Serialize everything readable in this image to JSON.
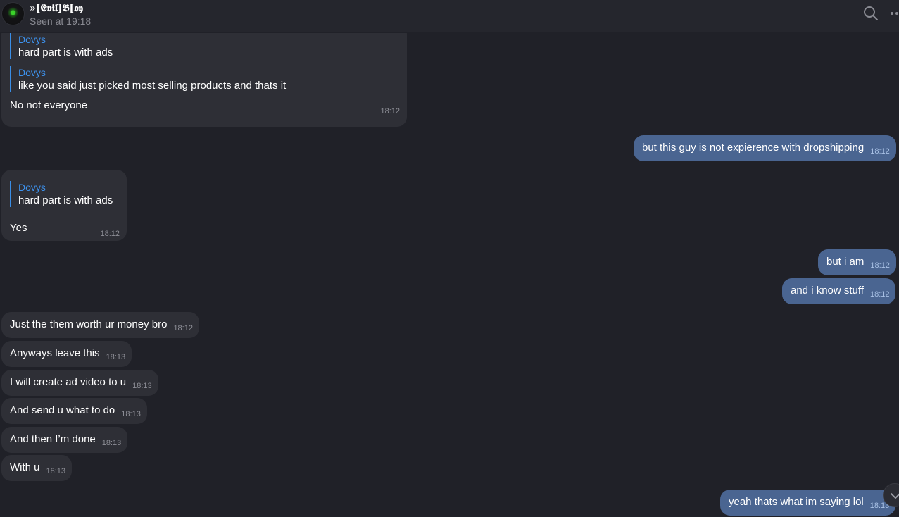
{
  "header": {
    "contact_name": "»[𝕰𝖛𝖎𝖑]𝕭[𝖔𝖞",
    "status": "Seen at 19:18",
    "search_icon": "search-icon",
    "more_icon": "more-icon"
  },
  "messages": [
    {
      "direction": "in",
      "replies": [
        {
          "author": "Dovys",
          "text": "hard part is with ads"
        },
        {
          "author": "Dovys",
          "text": "like you said just picked most selling products and thats it"
        }
      ],
      "text": "No not everyone",
      "time": "18:12"
    },
    {
      "direction": "out",
      "text": "but this guy is not expierence with dropshipping",
      "time": "18:12"
    },
    {
      "direction": "in",
      "replies": [
        {
          "author": "Dovys",
          "text": "hard part is with ads"
        }
      ],
      "text": "Yes",
      "time": "18:12"
    },
    {
      "direction": "out",
      "text": "but i am",
      "time": "18:12"
    },
    {
      "direction": "out",
      "text": "and i know stuff",
      "time": "18:12"
    },
    {
      "direction": "in",
      "text": "Just the them worth ur money bro",
      "time": "18:12"
    },
    {
      "direction": "in",
      "text": "Anyways leave this",
      "time": "18:13"
    },
    {
      "direction": "in",
      "text": "I will create ad video to u",
      "time": "18:13"
    },
    {
      "direction": "in",
      "text": "And send u what to do",
      "time": "18:13"
    },
    {
      "direction": "in",
      "text": "And then I’m done",
      "time": "18:13"
    },
    {
      "direction": "in",
      "text": "With u",
      "time": "18:13"
    },
    {
      "direction": "out",
      "text": "yeah thats what im saying lol",
      "time": "18:13"
    }
  ],
  "colors": {
    "background": "#202128",
    "incoming_bubble": "#2e2f36",
    "outgoing_bubble": "#4a6591",
    "reply_accent": "#3a8ee6"
  },
  "scroll_down_icon": "chevron-down-icon"
}
